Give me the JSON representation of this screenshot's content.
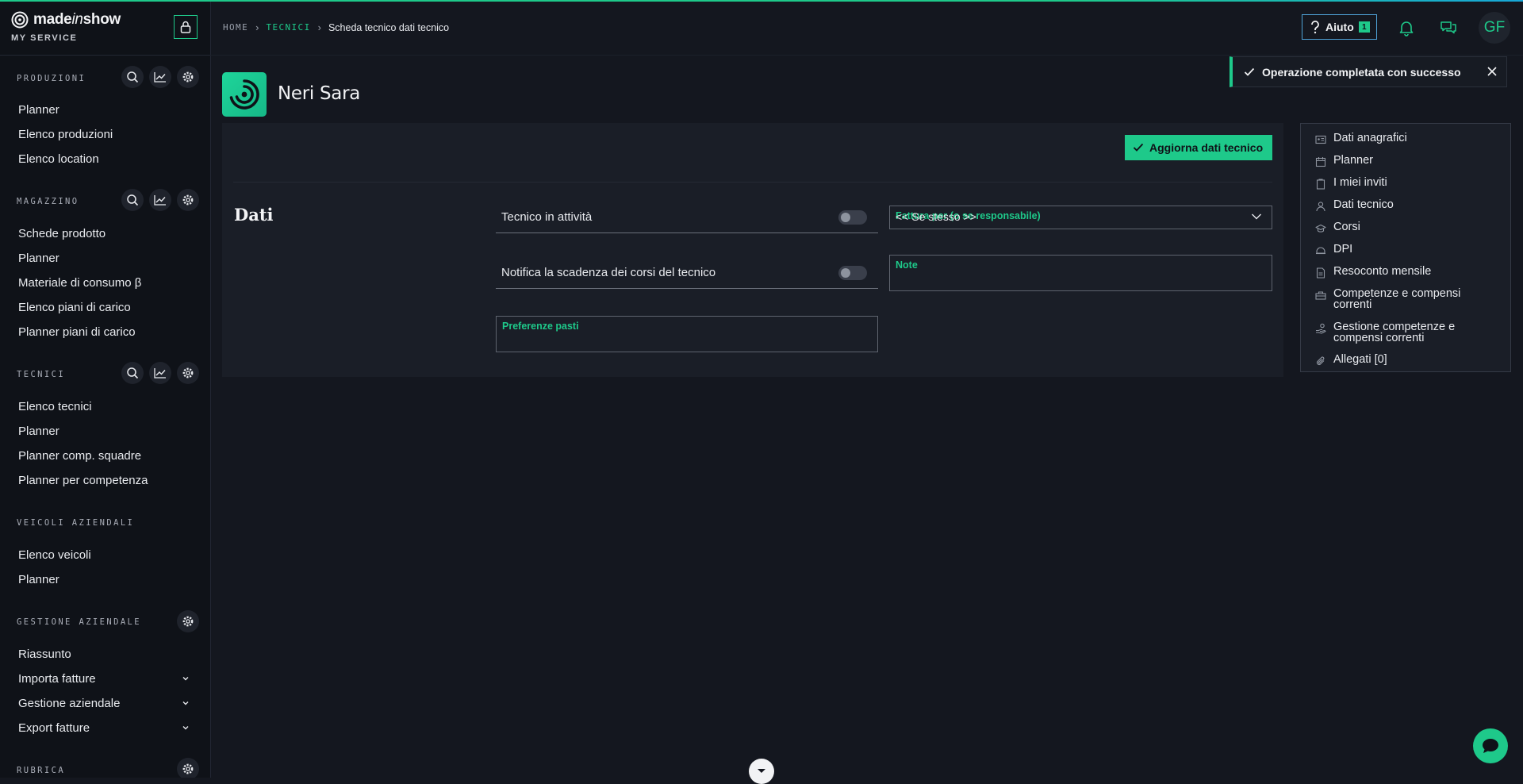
{
  "brand": {
    "name_prefix": "made",
    "name_mid": "in",
    "name_suffix": "show",
    "subtitle": "MY SERVICE"
  },
  "sidebar": {
    "produzioni": {
      "title": "PRODUZIONI",
      "items": [
        "Planner",
        "Elenco produzioni",
        "Elenco location"
      ]
    },
    "magazzino": {
      "title": "MAGAZZINO",
      "items": [
        "Schede prodotto",
        "Planner",
        "Materiale di consumo β",
        "Elenco piani di carico",
        "Planner piani di carico"
      ]
    },
    "tecnici": {
      "title": "TECNICI",
      "items": [
        "Elenco tecnici",
        "Planner",
        "Planner comp. squadre",
        "Planner per competenza"
      ]
    },
    "veicoli": {
      "title": "VEICOLI AZIENDALI",
      "items": [
        "Elenco veicoli",
        "Planner"
      ]
    },
    "gestione": {
      "title": "GESTIONE AZIENDALE",
      "items": [
        "Riassunto",
        "Importa fatture",
        "Gestione aziendale",
        "Export fatture"
      ]
    },
    "rubrica": {
      "title": "RUBRICA"
    }
  },
  "breadcrumb": {
    "home": "HOME",
    "tecnici": "TECNICI",
    "current": "Scheda tecnico dati tecnico"
  },
  "header": {
    "help_label": "Aiuto",
    "help_badge": "1",
    "avatar_initials": "GF"
  },
  "toast": {
    "message": "Operazione completata con successo"
  },
  "profile": {
    "name": "Neri Sara"
  },
  "form": {
    "update_button": "Aggiorna dati tecnico",
    "section_title": "Dati",
    "toggle_active_label": "Tecnico in attività",
    "toggle_notify_label": "Notifica la scadenza dei corsi del tecnico",
    "select_label": "Fattura per (o se responsabile)",
    "select_value": "<< Se stesso >>",
    "note_label": "Note",
    "meals_label": "Preferenze pasti"
  },
  "right_nav": [
    "Dati anagrafici",
    "Planner",
    "I miei inviti",
    "Dati tecnico",
    "Corsi",
    "DPI",
    "Resoconto mensile",
    "Competenze e compensi correnti",
    "Gestione competenze e compensi correnti",
    "Allegati [0]"
  ],
  "colors": {
    "accent": "#1ec98a",
    "help_border": "#4fa3d8",
    "background": "#14171f"
  }
}
